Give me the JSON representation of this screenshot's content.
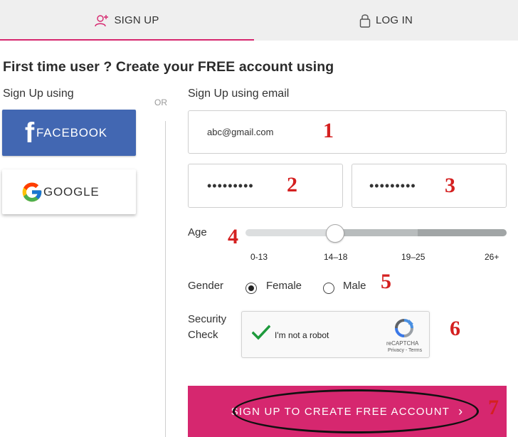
{
  "tabs": {
    "signup_label": "SIGN UP",
    "login_label": "LOG IN",
    "signup_icon": "add-user-icon",
    "login_icon": "lock-icon",
    "accent_color": "#d6276f"
  },
  "heading": "First time user ? Create your FREE account using",
  "social": {
    "label": "Sign Up using",
    "or_label": "OR",
    "facebook_label": "FACEBOOK",
    "facebook_color": "#4267b2",
    "google_label": "GOOGLE"
  },
  "email_form": {
    "label": "Sign Up using email",
    "email_value": "abc@gmail.com",
    "password_value": "•••••••••",
    "confirm_password_value": "•••••••••"
  },
  "age": {
    "label": "Age",
    "options": [
      "0-13",
      "14–18",
      "19–25",
      "26+"
    ],
    "selected": "14–18"
  },
  "gender": {
    "label": "Gender",
    "options": [
      "Female",
      "Male"
    ],
    "selected": "Female"
  },
  "security": {
    "label_line1": "Security",
    "label_line2": "Check",
    "captcha_text": "I'm not a robot",
    "captcha_brand": "reCAPTCHA",
    "captcha_terms": "Privacy - Terms"
  },
  "submit": {
    "label": "SIGN UP TO CREATE FREE ACCOUNT",
    "chevron": "›"
  },
  "annotations": [
    "1",
    "2",
    "3",
    "4",
    "5",
    "6",
    "7"
  ]
}
